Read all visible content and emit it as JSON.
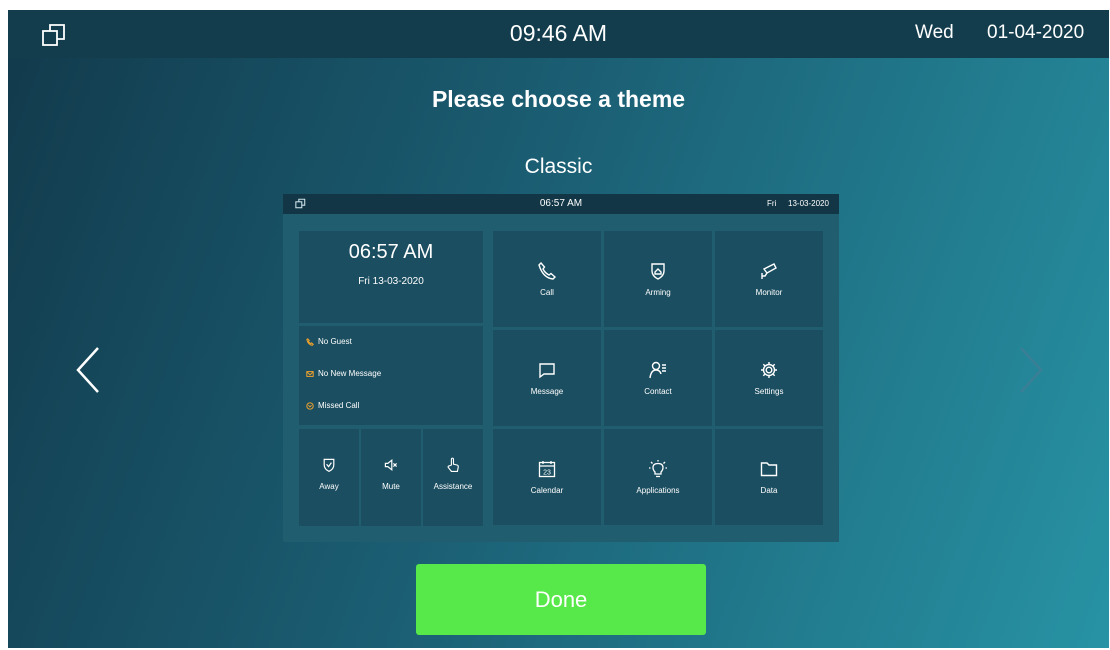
{
  "statusbar": {
    "time": "09:46 AM",
    "day": "Wed",
    "date": "01-04-2020"
  },
  "prompt": "Please choose a theme",
  "theme": {
    "name": "Classic"
  },
  "preview": {
    "bar": {
      "time": "06:57 AM",
      "day": "Fri",
      "date": "13-03-2020"
    },
    "clock": {
      "time": "06:57 AM",
      "date": "Fri 13-03-2020"
    },
    "notices": [
      "No Guest",
      "No New Message",
      "Missed Call"
    ],
    "quick": [
      "Away",
      "Mute",
      "Assistance"
    ],
    "grid": [
      "Call",
      "Arming",
      "Monitor",
      "Message",
      "Contact",
      "Settings",
      "Calendar",
      "Applications",
      "Data"
    ],
    "calendar_day": "23"
  },
  "done_label": "Done",
  "colors": {
    "accent_green": "#57e849",
    "notice_icon": "#f2a32b",
    "statusbar": "#133d4d"
  },
  "icons": [
    "restore-window-icon",
    "chevron-left-icon",
    "chevron-right-icon",
    "phone-icon",
    "shield-home-icon",
    "camera-icon",
    "message-icon",
    "contact-icon",
    "gear-icon",
    "calendar-icon",
    "bulb-icon",
    "folder-icon",
    "mail-icon",
    "missed-call-icon",
    "mute-icon",
    "hand-pointer-icon"
  ]
}
